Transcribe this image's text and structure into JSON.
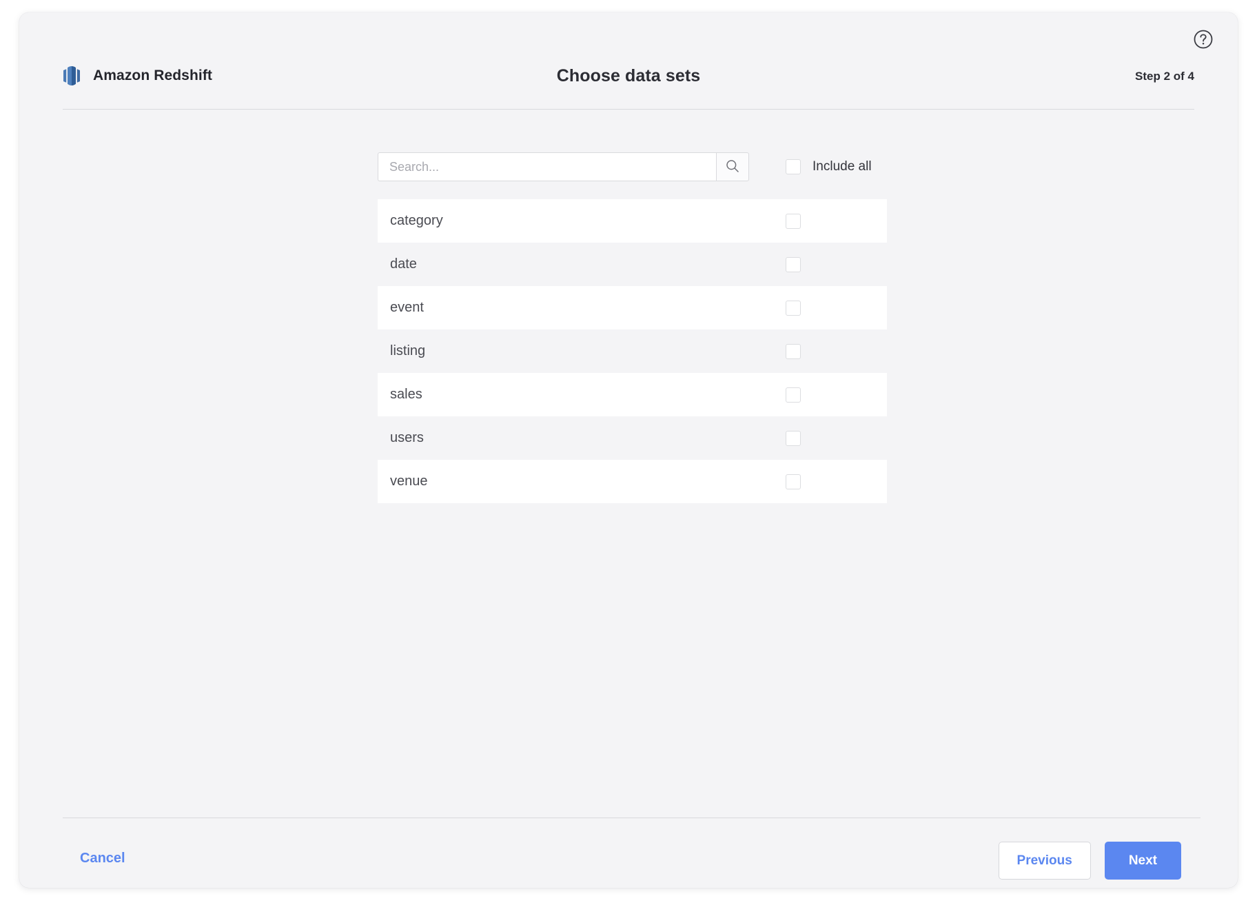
{
  "header": {
    "brand_name": "Amazon Redshift",
    "brand_logo_icon": "redshift-logo-icon",
    "title": "Choose data sets",
    "step_indicator": "Step 2 of 4",
    "help_icon": "question-circle-icon"
  },
  "search": {
    "placeholder": "Search...",
    "value": "",
    "search_icon": "search-icon"
  },
  "include_all": {
    "label": "Include all",
    "checked": false
  },
  "datasets": [
    {
      "name": "category",
      "checked": false
    },
    {
      "name": "date",
      "checked": false
    },
    {
      "name": "event",
      "checked": false
    },
    {
      "name": "listing",
      "checked": false
    },
    {
      "name": "sales",
      "checked": false
    },
    {
      "name": "users",
      "checked": false
    },
    {
      "name": "venue",
      "checked": false
    }
  ],
  "footer": {
    "cancel_label": "Cancel",
    "previous_label": "Previous",
    "next_label": "Next"
  },
  "colors": {
    "accent": "#5b87f0",
    "page_background": "#ffffff",
    "card_background": "#f4f4f6",
    "row_alt_background": "#ffffff",
    "text_primary": "#2c2d34",
    "text_secondary": "#4a4b52",
    "border": "#d8d9dd"
  }
}
